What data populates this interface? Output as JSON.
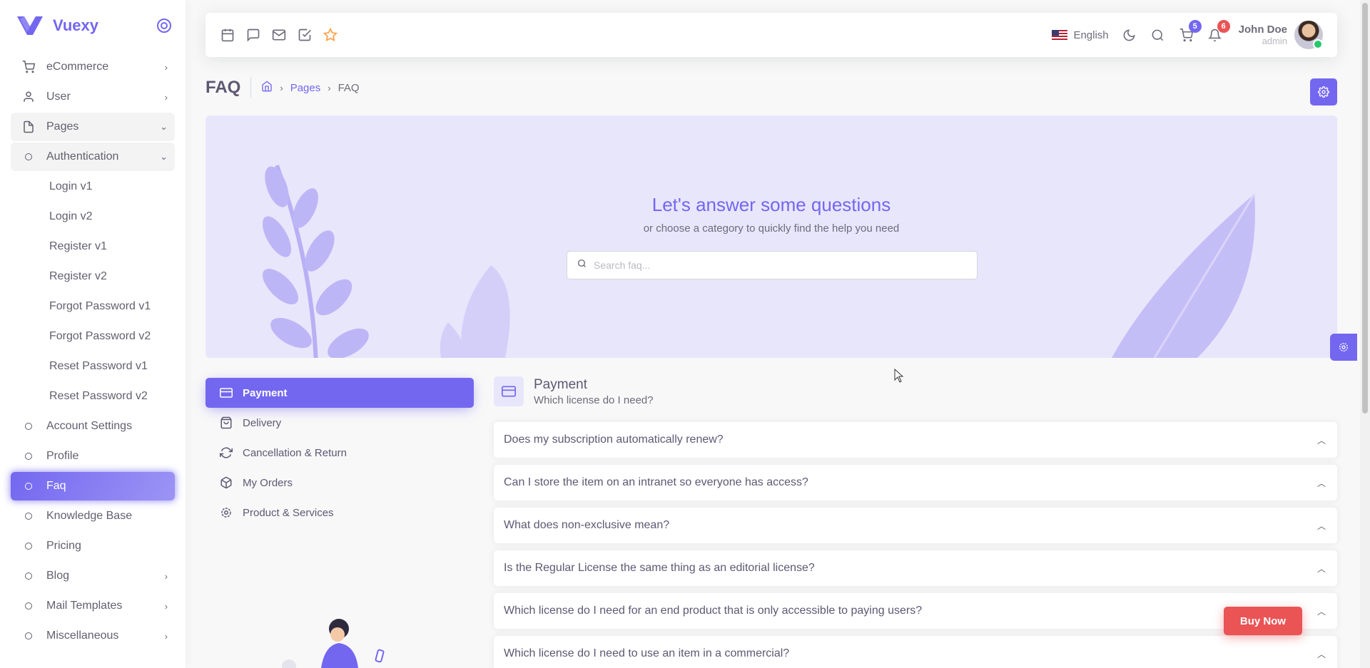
{
  "brand": {
    "name": "Vuexy"
  },
  "sidebar": {
    "items": [
      {
        "label": "eCommerce",
        "icon": "shopping-cart-icon",
        "chevron": "›"
      },
      {
        "label": "User",
        "icon": "user-icon",
        "chevron": "›"
      },
      {
        "label": "Pages",
        "icon": "file-icon",
        "chevron": "⌄"
      },
      {
        "label": "Authentication",
        "icon": "circle-icon",
        "chevron": "⌄"
      },
      {
        "label": "Login v1"
      },
      {
        "label": "Login v2"
      },
      {
        "label": "Register v1"
      },
      {
        "label": "Register v2"
      },
      {
        "label": "Forgot Password v1"
      },
      {
        "label": "Forgot Password v2"
      },
      {
        "label": "Reset Password v1"
      },
      {
        "label": "Reset Password v2"
      },
      {
        "label": "Account Settings",
        "icon": "circle-icon"
      },
      {
        "label": "Profile",
        "icon": "circle-icon"
      },
      {
        "label": "Faq",
        "icon": "circle-icon",
        "active": true
      },
      {
        "label": "Knowledge Base",
        "icon": "circle-icon"
      },
      {
        "label": "Pricing",
        "icon": "circle-icon"
      },
      {
        "label": "Blog",
        "icon": "circle-icon",
        "chevron": "›"
      },
      {
        "label": "Mail Templates",
        "icon": "circle-icon",
        "chevron": "›"
      },
      {
        "label": "Miscellaneous",
        "icon": "circle-icon",
        "chevron": "›"
      }
    ]
  },
  "navbar": {
    "bookmarks": [
      "calendar-icon",
      "message-square-icon",
      "mail-icon",
      "check-square-icon",
      "star-icon"
    ],
    "language": "English",
    "cart_count": "5",
    "notification_count": "6",
    "user_name": "John Doe",
    "user_role": "admin"
  },
  "header": {
    "title": "FAQ",
    "breadcrumb": {
      "link": "Pages",
      "current": "FAQ"
    }
  },
  "hero": {
    "title": "Let's answer some questions",
    "subtitle": "or choose a category to quickly find the help you need",
    "search_placeholder": "Search faq..."
  },
  "categories": [
    {
      "label": "Payment",
      "icon": "credit-card-icon",
      "active": true
    },
    {
      "label": "Delivery",
      "icon": "shopping-bag-icon"
    },
    {
      "label": "Cancellation & Return",
      "icon": "refresh-icon"
    },
    {
      "label": "My Orders",
      "icon": "package-icon"
    },
    {
      "label": "Product & Services",
      "icon": "settings-icon"
    }
  ],
  "faq": {
    "title": "Payment",
    "subtitle": "Which license do I need?",
    "questions": [
      "Does my subscription automatically renew?",
      "Can I store the item on an intranet so everyone has access?",
      "What does non-exclusive mean?",
      "Is the Regular License the same thing as an editorial license?",
      "Which license do I need for an end product that is only accessible to paying users?",
      "Which license do I need to use an item in a commercial?"
    ]
  },
  "buy_now": "Buy Now",
  "colors": {
    "primary": "#7367f0",
    "danger": "#ea5455",
    "hero_bg": "#e8e6fb"
  }
}
